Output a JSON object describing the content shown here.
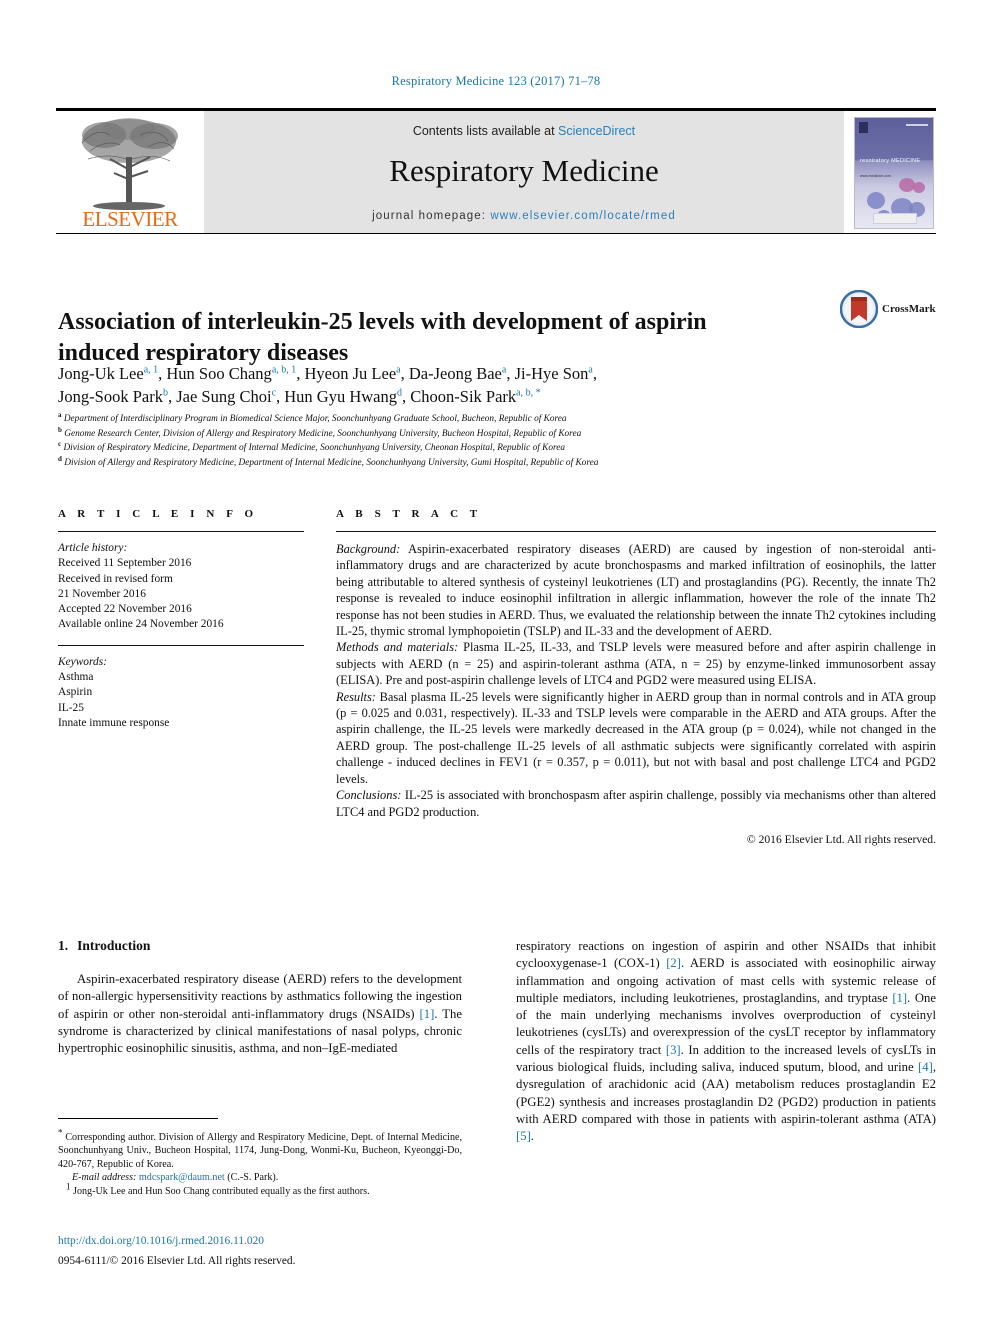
{
  "running_head": "Respiratory Medicine 123 (2017) 71–78",
  "masthead": {
    "contents_prefix": "Contents lists available at ",
    "contents_link": "ScienceDirect",
    "journal_name": "Respiratory Medicine",
    "homepage_prefix": "journal homepage: ",
    "homepage_url": "www.elsevier.com/locate/rmed",
    "publisher": "ELSEVIER",
    "cover_title": "resoiratory MEDICINE",
    "cover_sub": "www.medicine.com"
  },
  "crossmark": {
    "label": "CrossMark"
  },
  "article": {
    "title": "Association of interleukin-25 levels with development of aspirin induced respiratory diseases",
    "authors_line1": "Jong-Uk Lee a, 1, Hun Soo Chang a, b, 1, Hyeon Ju Lee a, Da-Jeong Bae a, Ji-Hye Son a,",
    "authors_line2": "Jong-Sook Park b, Jae Sung Choi c, Hun Gyu Hwang d, Choon-Sik Park a, b, *",
    "authors": [
      {
        "name": "Jong-Uk Lee",
        "marks": "a, 1"
      },
      {
        "name": "Hun Soo Chang",
        "marks": "a, b, 1"
      },
      {
        "name": "Hyeon Ju Lee",
        "marks": "a"
      },
      {
        "name": "Da-Jeong Bae",
        "marks": "a"
      },
      {
        "name": "Ji-Hye Son",
        "marks": "a"
      },
      {
        "name": "Jong-Sook Park",
        "marks": "b"
      },
      {
        "name": "Jae Sung Choi",
        "marks": "c"
      },
      {
        "name": "Hun Gyu Hwang",
        "marks": "d"
      },
      {
        "name": "Choon-Sik Park",
        "marks": "a, b, *"
      }
    ],
    "affiliations": [
      {
        "marker": "a",
        "text": "Department of Interdisciplinary Program in Biomedical Science Major, Soonchunhyang Graduate School, Bucheon, Republic of Korea"
      },
      {
        "marker": "b",
        "text": "Genome Research Center, Division of Allergy and Respiratory Medicine, Soonchunhyang University, Bucheon Hospital, Republic of Korea"
      },
      {
        "marker": "c",
        "text": "Division of Respiratory Medicine, Department of Internal Medicine, Soonchunhyang University, Cheonan Hospital, Republic of Korea"
      },
      {
        "marker": "d",
        "text": "Division of Allergy and Respiratory Medicine, Department of Internal Medicine, Soonchunhyang University, Gumi Hospital, Republic of Korea"
      }
    ]
  },
  "article_info": {
    "heading": "A R T I C L E    I N F O",
    "history_label": "Article history:",
    "history": [
      "Received 11 September 2016",
      "Received in revised form",
      "21 November 2016",
      "Accepted 22 November 2016",
      "Available online 24 November 2016"
    ],
    "keywords_label": "Keywords:",
    "keywords": [
      "Asthma",
      "Aspirin",
      "IL-25",
      "Innate immune response"
    ]
  },
  "abstract": {
    "heading": "A B S T R A C T",
    "sections": [
      {
        "label": "Background:",
        "text": " Aspirin-exacerbated respiratory diseases (AERD) are caused by ingestion of non-steroidal anti-inflammatory drugs and are characterized by acute bronchospasms and marked infiltration of eosinophils, the latter being attributable to altered synthesis of cysteinyl leukotrienes (LT) and prostaglandins (PG). Recently, the innate Th2 response is revealed to induce eosinophil infiltration in allergic inflammation, however the role of the innate Th2 response has not been studies in AERD. Thus, we evaluated the relationship between the innate Th2 cytokines including IL-25, thymic stromal lymphopoietin (TSLP) and IL-33 and the development of AERD."
      },
      {
        "label": "Methods and materials:",
        "text": " Plasma IL-25, IL-33, and TSLP levels were measured before and after aspirin challenge in subjects with AERD (n = 25) and aspirin-tolerant asthma (ATA, n = 25) by enzyme-linked immunosorbent assay (ELISA). Pre and post-aspirin challenge levels of LTC4 and PGD2 were measured using ELISA."
      },
      {
        "label": "Results:",
        "text": " Basal plasma IL-25 levels were significantly higher in AERD group than in normal controls and in ATA group (p = 0.025 and 0.031, respectively). IL-33 and TSLP levels were comparable in the AERD and ATA groups. After the aspirin challenge, the IL-25 levels were markedly decreased in the ATA group (p = 0.024), while not changed in the AERD group. The post-challenge IL-25 levels of all asthmatic subjects were significantly correlated with aspirin challenge - induced declines in FEV1 (r = 0.357, p = 0.011), but not with basal and post challenge LTC4 and PGD2 levels."
      },
      {
        "label": "Conclusions:",
        "text": " IL-25 is associated with bronchospasm after aspirin challenge, possibly via mechanisms other than altered LTC4 and PGD2 production."
      }
    ],
    "copyright": "© 2016 Elsevier Ltd. All rights reserved."
  },
  "introduction": {
    "number": "1.",
    "heading": "Introduction",
    "left_paragraph_pre": "Aspirin-exacerbated respiratory disease (AERD) refers to the development of non-allergic hypersensitivity reactions by asthmatics following the ingestion of aspirin or other non-steroidal anti-inflammatory drugs (NSAIDs) ",
    "left_ref_1": "[1]",
    "left_paragraph_post": ". The syndrome is characterized by clinical manifestations of nasal polyps, chronic hypertrophic eosinophilic sinusitis, asthma, and non–IgE-mediated",
    "right_seg_1": "respiratory reactions on ingestion of aspirin and other NSAIDs that inhibit cyclooxygenase-1 (COX-1) ",
    "right_ref_2": "[2]",
    "right_seg_2": ". AERD is associated with eosinophilic airway inflammation and ongoing activation of mast cells with systemic release of multiple mediators, including leukotrienes, prostaglandins, and tryptase ",
    "right_ref_1": "[1]",
    "right_seg_3": ". One of the main underlying mechanisms involves overproduction of cysteinyl leukotrienes (cysLTs) and overexpression of the cysLT receptor by inflammatory cells of the respiratory tract ",
    "right_ref_3": "[3]",
    "right_seg_4": ". In addition to the increased levels of cysLTs in various biological fluids, including saliva, induced sputum, blood, and urine ",
    "right_ref_4": "[4]",
    "right_seg_5": ", dysregulation of arachidonic acid (AA) metabolism reduces prostaglandin E2 (PGE2) synthesis and increases prostaglandin D2 (PGD2) production in patients with AERD compared with those in patients with aspirin-tolerant asthma (ATA) ",
    "right_ref_5": "[5]",
    "right_seg_6": "."
  },
  "footnotes": {
    "corresponding": "Corresponding author. Division of Allergy and Respiratory Medicine, Dept. of Internal Medicine, Soonchunhyang Univ., Bucheon Hospital, 1174, Jung-Dong, Wonmi-Ku, Bucheon, Kyeonggi-Do, 420-767, Republic of Korea.",
    "email_label": "E-mail address:",
    "email": "mdcspark@daum.net",
    "email_suffix": " (C.-S. Park).",
    "equal_contrib_marker": "1",
    "equal_contrib": "Jong-Uk Lee and Hun Soo Chang contributed equally as the first authors."
  },
  "footer": {
    "doi": "http://dx.doi.org/10.1016/j.rmed.2016.11.020",
    "issn": "0954-6111/© 2016 Elsevier Ltd. All rights reserved."
  },
  "colors": {
    "link_blue": "#1878a8",
    "sciencedirect_blue": "#2b7fba",
    "elsevier_orange": "#ea6a10"
  }
}
